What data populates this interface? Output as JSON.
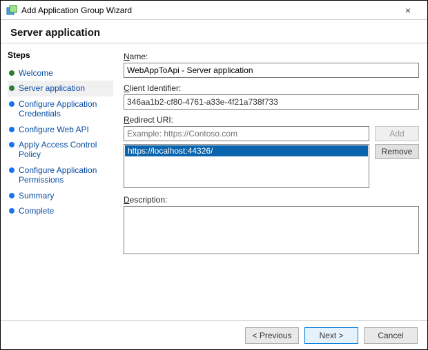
{
  "window": {
    "title": "Add Application Group Wizard",
    "close_label": "×"
  },
  "heading": "Server application",
  "sidebar": {
    "title": "Steps",
    "items": [
      {
        "label": "Welcome",
        "state": "done"
      },
      {
        "label": "Server application",
        "state": "current"
      },
      {
        "label": "Configure Application Credentials",
        "state": "pending"
      },
      {
        "label": "Configure Web API",
        "state": "pending"
      },
      {
        "label": "Apply Access Control Policy",
        "state": "pending"
      },
      {
        "label": "Configure Application Permissions",
        "state": "pending"
      },
      {
        "label": "Summary",
        "state": "pending"
      },
      {
        "label": "Complete",
        "state": "pending"
      }
    ]
  },
  "form": {
    "name_label": "Name:",
    "name_underline": "N",
    "name_value": "WebAppToApi - Server application",
    "cid_label": "Client Identifier:",
    "cid_underline": "C",
    "cid_value": "346aa1b2-cf80-4761-a33e-4f21a738f733",
    "redirect_label": "Redirect URI:",
    "redirect_underline": "R",
    "redirect_placeholder": "Example: https://Contoso.com",
    "redirect_value": "",
    "add_label": "Add",
    "remove_label": "Remove",
    "redirect_items": [
      {
        "value": "https://localhost:44326/",
        "selected": true
      }
    ],
    "description_label": "Description:",
    "description_underline": "D",
    "description_value": ""
  },
  "footer": {
    "previous": "< Previous",
    "next": "Next >",
    "cancel": "Cancel"
  }
}
